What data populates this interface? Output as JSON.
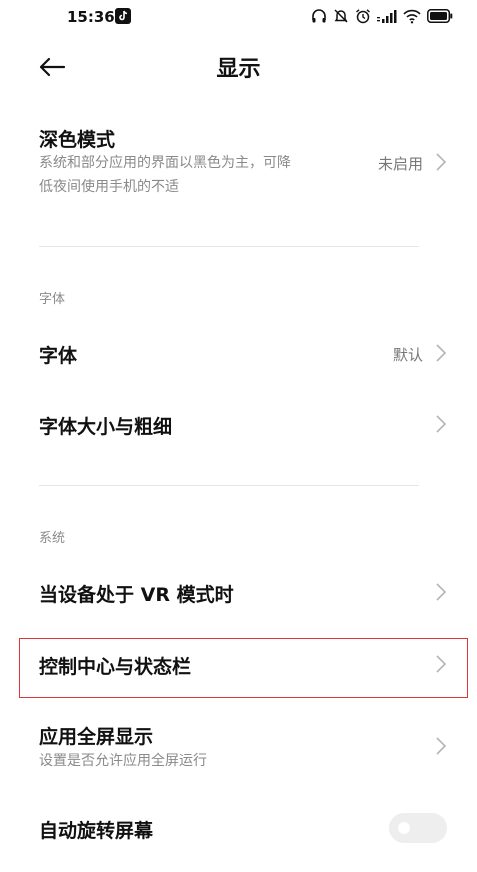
{
  "status_bar": {
    "time": "15:36"
  },
  "header": {
    "title": "显示"
  },
  "dark_mode": {
    "title": "深色模式",
    "desc_line1": "系统和部分应用的界面以黑色为主，可降",
    "desc_line2": "低夜间使用手机的不适",
    "value": "未启用"
  },
  "font_section": {
    "label": "字体",
    "font": {
      "title": "字体",
      "value": "默认"
    },
    "font_size": {
      "title": "字体大小与粗细"
    }
  },
  "system_section": {
    "label": "系统",
    "vr_mode": {
      "title": "当设备处于 VR 模式时"
    },
    "control_center": {
      "title": "控制中心与状态栏"
    },
    "fullscreen": {
      "title": "应用全屏显示",
      "desc": "设置是否允许应用全屏运行"
    },
    "auto_rotate": {
      "title": "自动旋转屏幕",
      "enabled": false
    }
  },
  "colors": {
    "highlight": "#e0353b",
    "toggle_off": "#eeeeee"
  }
}
